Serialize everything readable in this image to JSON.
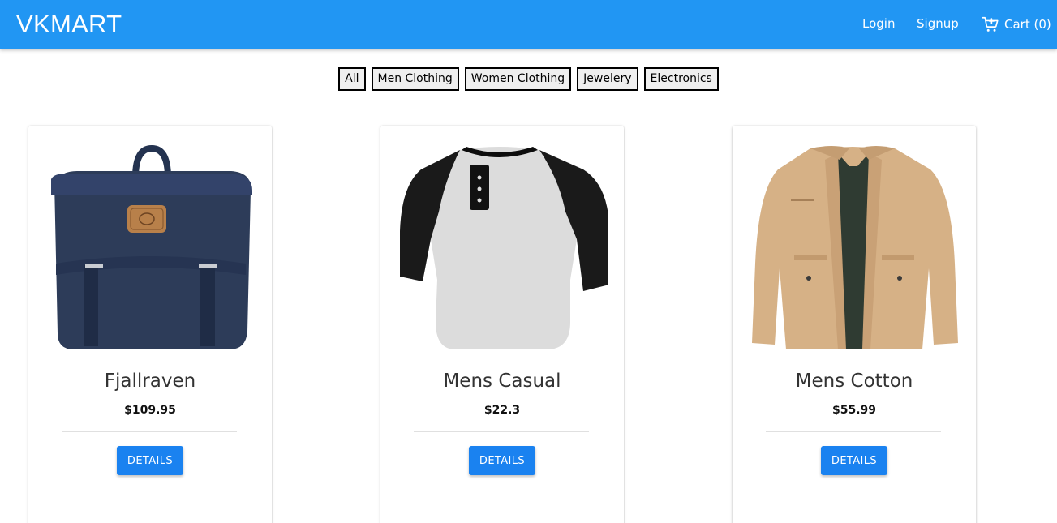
{
  "brand": "VKMART",
  "nav": {
    "login": "Login",
    "signup": "Signup",
    "cart": "Cart (0)",
    "cart_icon": "cart-icon"
  },
  "filters": [
    "All",
    "Men Clothing",
    "Women Clothing",
    "Jewelery",
    "Electronics"
  ],
  "products": [
    {
      "title": "Fjallraven",
      "price": "$109.95",
      "button": "DETAILS",
      "image": "navy-backpack"
    },
    {
      "title": "Mens Casual",
      "price": "$22.3",
      "button": "DETAILS",
      "image": "raglan-henley-shirt"
    },
    {
      "title": "Mens Cotton",
      "price": "$55.99",
      "button": "DETAILS",
      "image": "khaki-cotton-jacket"
    }
  ],
  "colors": {
    "appbar": "#2196f3",
    "button": "#1a82f0",
    "backpack": "#2b3a55",
    "jacket": "#d9b48a"
  }
}
